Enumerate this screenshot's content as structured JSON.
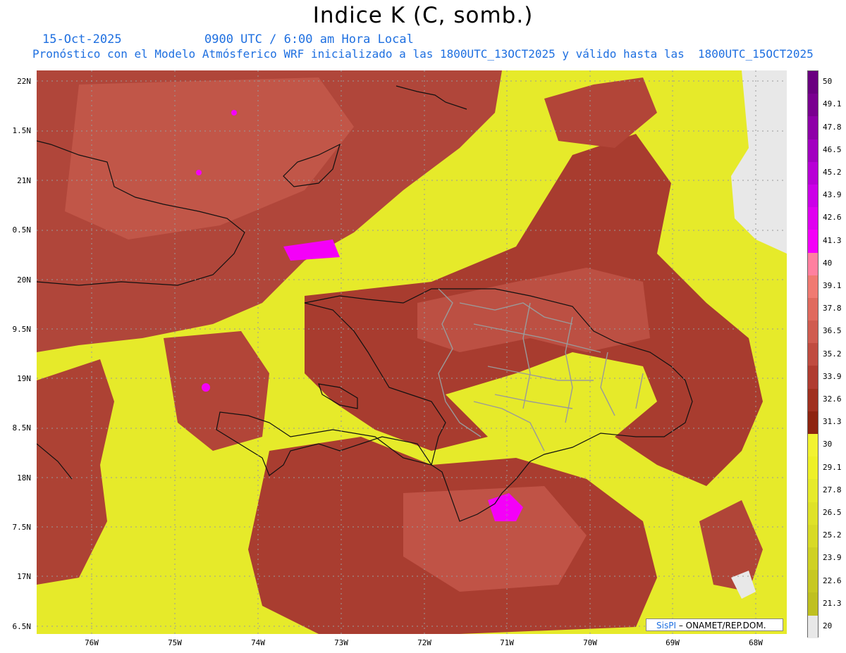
{
  "title": "Indice K (C, somb.)",
  "date": "15-Oct-2025",
  "time": "0900 UTC / 6:00 am Hora Local",
  "forecast_line": "Pronóstico con el Modelo Atmósferico WRF inicializado a las 1800UTC_13OCT2025 y válido hasta las  1800UTC_15OCT2025",
  "lat_labels": [
    "22N",
    "1.5N",
    "21N",
    "0.5N",
    "20N",
    "9.5N",
    "19N",
    "8.5N",
    "18N",
    "7.5N",
    "17N",
    "6.5N"
  ],
  "lon_labels": [
    "76W",
    "75W",
    "74W",
    "73W",
    "72W",
    "71W",
    "70W",
    "69W",
    "68W"
  ],
  "colorbar": {
    "labels": [
      "50",
      "49.1",
      "47.8",
      "46.5",
      "45.2",
      "43.9",
      "42.6",
      "41.3",
      "40",
      "39.1",
      "37.8",
      "36.5",
      "35.2",
      "33.9",
      "32.6",
      "31.3",
      "30",
      "29.1",
      "27.8",
      "26.5",
      "25.2",
      "23.9",
      "22.6",
      "21.3",
      "20"
    ],
    "colors": [
      "#6a0080",
      "#7a0090",
      "#8e00a8",
      "#a200c0",
      "#b800d6",
      "#cc00e8",
      "#e000f0",
      "#f400f8",
      "#ff80a0",
      "#f07a72",
      "#e06a5e",
      "#d05c50",
      "#c04c40",
      "#b03c30",
      "#a0301f",
      "#8e2410",
      "#f2f230",
      "#eef027",
      "#e6ea2a",
      "#dfe228",
      "#d8da26",
      "#cfd124",
      "#c7c822",
      "#bfc020",
      "#e8e8e8"
    ]
  },
  "credit": {
    "brand": "SisPI",
    "text": "– ONAMET/REP.DOM."
  }
}
